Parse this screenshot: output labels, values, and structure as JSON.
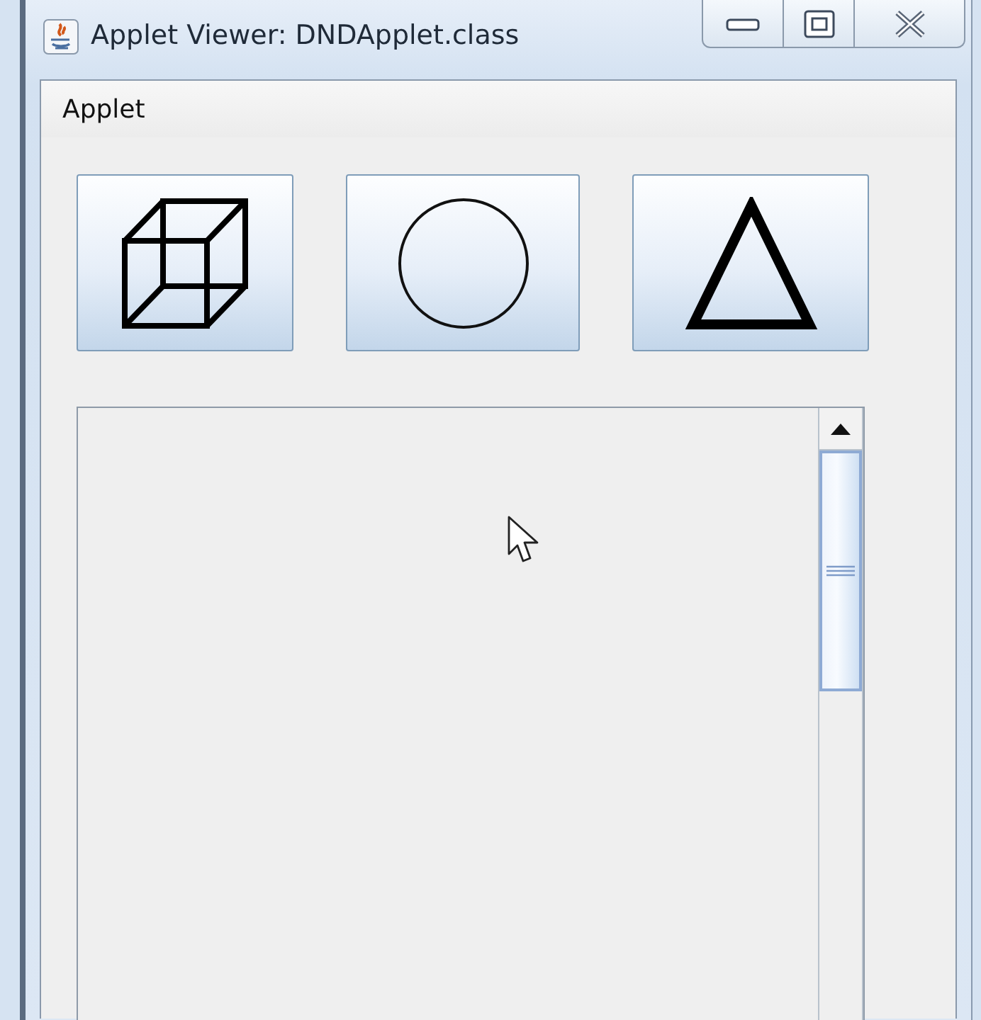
{
  "window": {
    "title": "Applet Viewer: DNDApplet.class"
  },
  "menu_bar": {
    "items": [
      "Applet"
    ]
  },
  "shape_buttons": [
    {
      "kind": "cube"
    },
    {
      "kind": "circle"
    },
    {
      "kind": "triangle"
    }
  ]
}
